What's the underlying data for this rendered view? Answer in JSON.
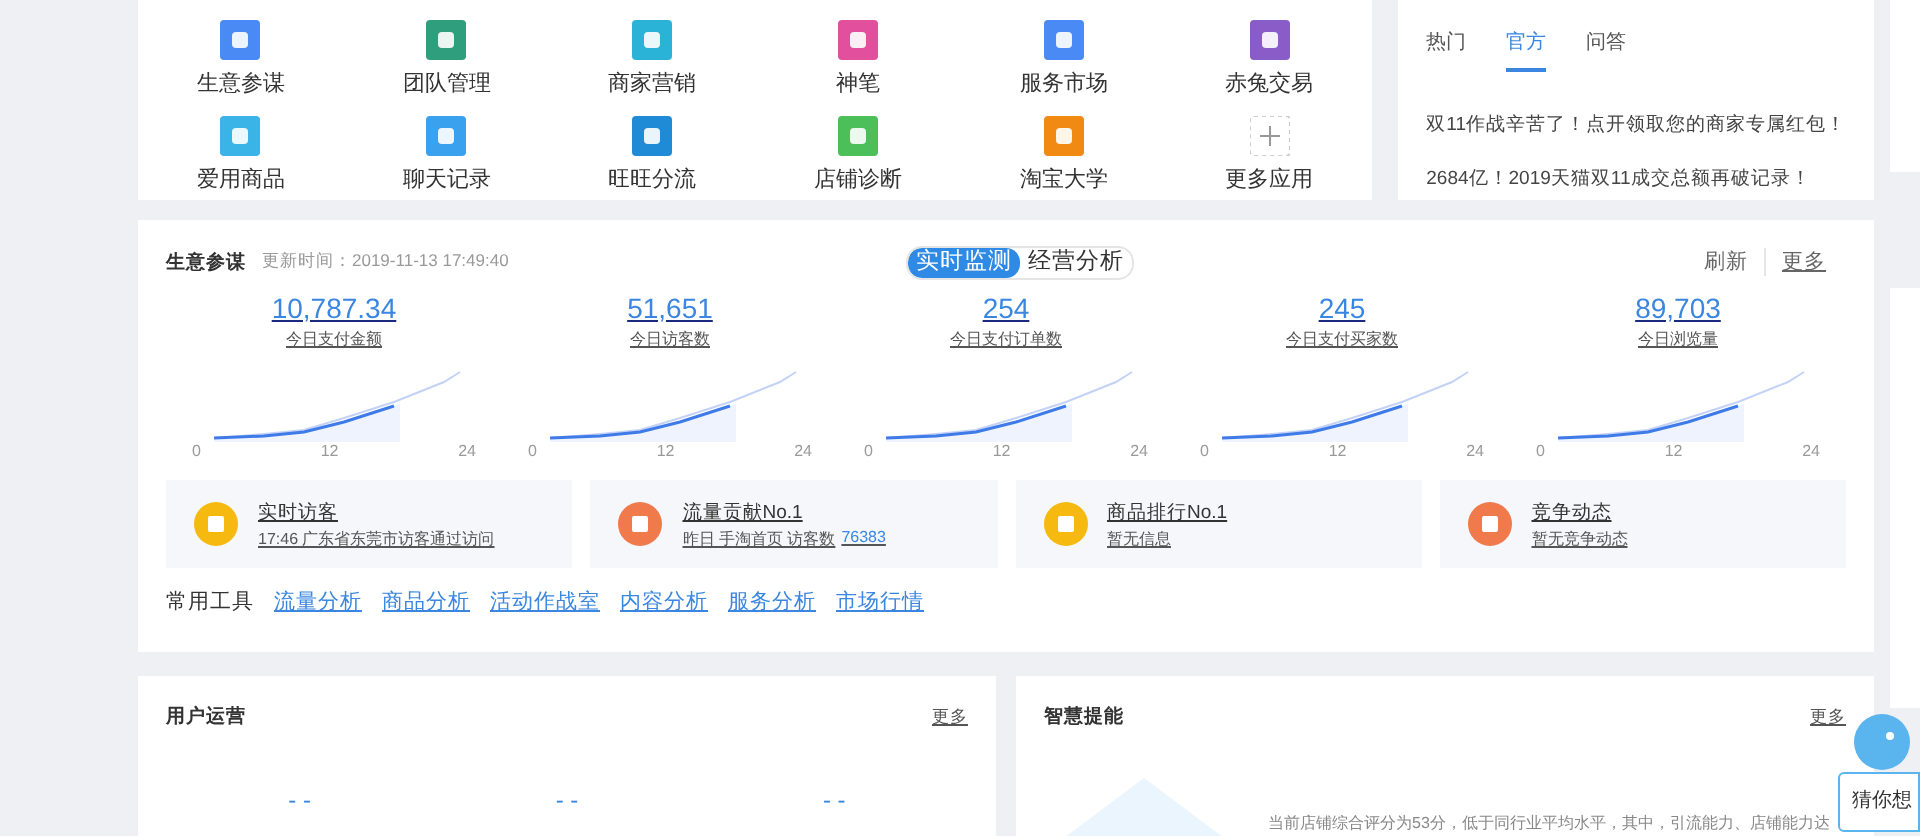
{
  "apps": [
    {
      "label": "生意参谋",
      "color": "#4a8af4"
    },
    {
      "label": "团队管理",
      "color": "#2e9e7c"
    },
    {
      "label": "商家营销",
      "color": "#2ab3d6"
    },
    {
      "label": "神笔",
      "color": "#e24f9c"
    },
    {
      "label": "服务市场",
      "color": "#4a8af4"
    },
    {
      "label": "赤兔交易",
      "color": "#8a5cc7"
    },
    {
      "label": "爱用商品",
      "color": "#3ab4e6"
    },
    {
      "label": "聊天记录",
      "color": "#3aa1ee"
    },
    {
      "label": "旺旺分流",
      "color": "#1f8bd6"
    },
    {
      "label": "店铺诊断",
      "color": "#4cbf5b"
    },
    {
      "label": "淘宝大学",
      "color": "#f08a12"
    },
    {
      "label": "更多应用",
      "color": "#cccccc"
    }
  ],
  "news": {
    "tabs": [
      {
        "label": "热门",
        "selected": false
      },
      {
        "label": "官方",
        "selected": true
      },
      {
        "label": "问答",
        "selected": false
      }
    ],
    "items": [
      "双11作战辛苦了！点开领取您的商家专属红包！",
      "2684亿！2019天猫双11成交总额再破记录！"
    ]
  },
  "monitor": {
    "title": "生意参谋",
    "updated": "更新时间：2019-11-13 17:49:40",
    "modes": [
      {
        "label": "实时监测",
        "selected": true
      },
      {
        "label": "经营分析",
        "selected": false
      }
    ],
    "actions": [
      "刷新",
      "更多"
    ],
    "metrics": [
      {
        "value": "10,787.34",
        "label": "今日支付金额",
        "axis": [
          "0",
          "12",
          "24"
        ]
      },
      {
        "value": "51,651",
        "label": "今日访客数",
        "axis": [
          "0",
          "12",
          "24"
        ]
      },
      {
        "value": "254",
        "label": "今日支付订单数",
        "axis": [
          "0",
          "12",
          "24"
        ]
      },
      {
        "value": "245",
        "label": "今日支付买家数",
        "axis": [
          "0",
          "12",
          "24"
        ]
      },
      {
        "value": "89,703",
        "label": "今日浏览量",
        "axis": [
          "0",
          "12",
          "24"
        ]
      }
    ],
    "cards": [
      {
        "title": "实时访客",
        "detail": "17:46 广东省东莞市访客通过访问",
        "color": "#f5b90f"
      },
      {
        "title": "流量贡献No.1",
        "detail": "昨日 手淘首页 访客数",
        "link": "76383",
        "color": "#f07a4c"
      },
      {
        "title": "商品排行No.1",
        "detail": "暂无信息",
        "color": "#f5b90f"
      },
      {
        "title": "竞争动态",
        "detail": "暂无竞争动态",
        "color": "#f07a4c"
      }
    ],
    "tools_label": "常用工具",
    "tools": [
      "流量分析",
      "商品分析",
      "活动作战室",
      "内容分析",
      "服务分析",
      "市场行情"
    ]
  },
  "user_ops": {
    "title": "用户运营",
    "more": "更多",
    "values": [
      "- -",
      "- -",
      "- -"
    ]
  },
  "smart": {
    "title": "智慧提能",
    "more": "更多",
    "text": "当前店铺综合评分为53分，低于同行业平均水平，其中，引流能力、店铺能力达"
  },
  "assistant": {
    "label": "猜你想"
  }
}
